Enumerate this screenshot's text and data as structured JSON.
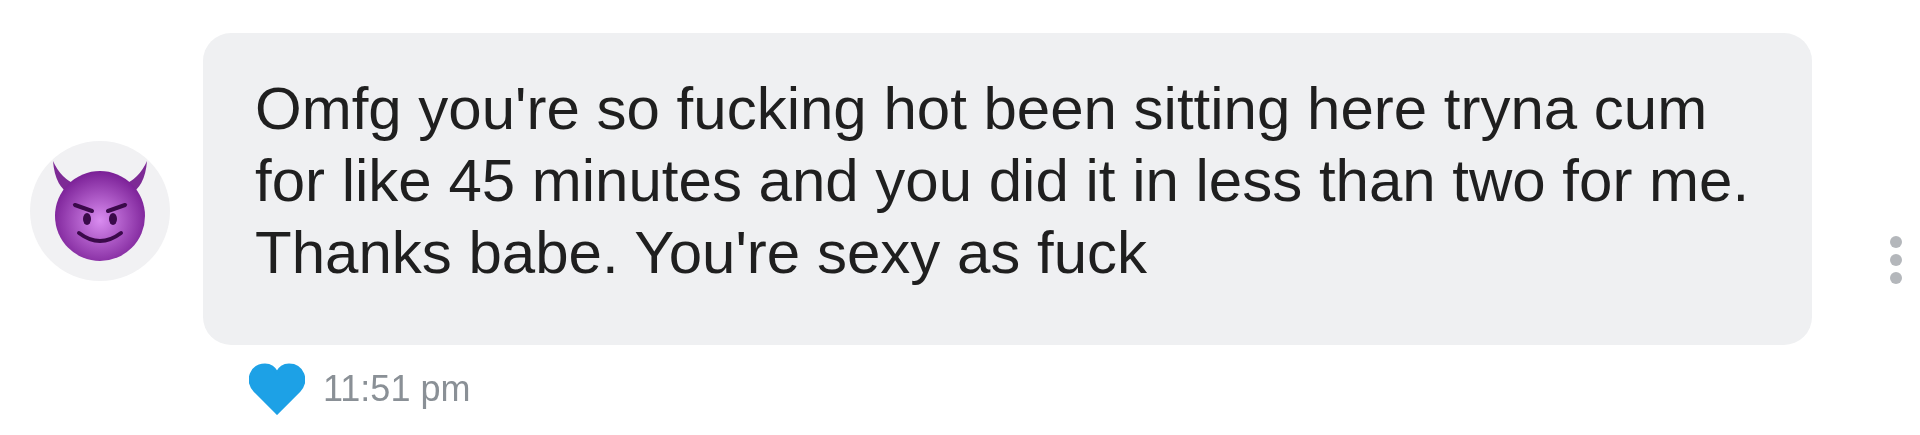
{
  "message": {
    "avatar": {
      "kind": "emoji"
    },
    "text": "Omfg you're so fucking hot been sitting here tryna cum for like 45 minutes and you did it in less than two for me. Thanks babe. You're sexy as fuck",
    "liked": true,
    "time": "11:51 pm"
  }
}
